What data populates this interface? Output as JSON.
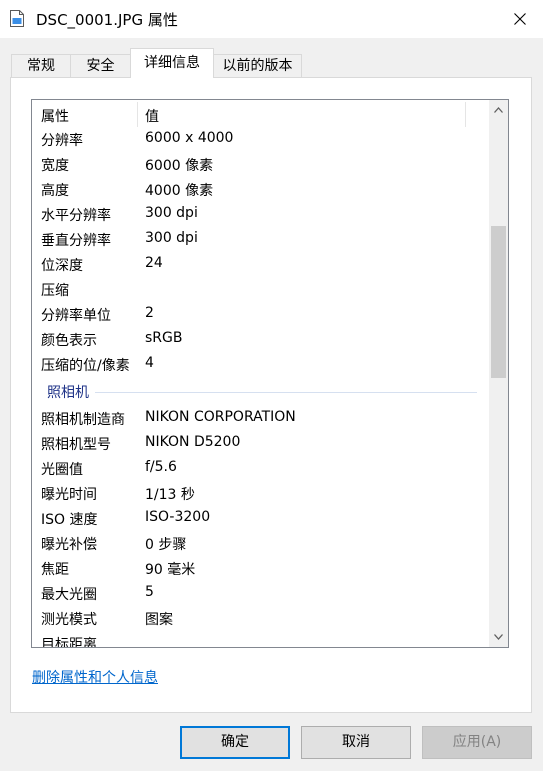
{
  "window": {
    "title": "DSC_0001.JPG 属性",
    "icon": "document-icon",
    "close_icon": "close-icon"
  },
  "tabs": [
    {
      "label": "常规",
      "active": false
    },
    {
      "label": "安全",
      "active": false
    },
    {
      "label": "详细信息",
      "active": true
    },
    {
      "label": "以前的版本",
      "active": false
    }
  ],
  "list": {
    "header": {
      "property": "属性",
      "value": "值"
    },
    "rows": [
      {
        "k": "分辨率",
        "v": "6000 x 4000"
      },
      {
        "k": "宽度",
        "v": "6000 像素"
      },
      {
        "k": "高度",
        "v": "4000 像素"
      },
      {
        "k": "水平分辨率",
        "v": "300 dpi"
      },
      {
        "k": "垂直分辨率",
        "v": "300 dpi"
      },
      {
        "k": "位深度",
        "v": "24"
      },
      {
        "k": "压缩",
        "v": ""
      },
      {
        "k": "分辨率单位",
        "v": "2"
      },
      {
        "k": "颜色表示",
        "v": "sRGB"
      },
      {
        "k": "压缩的位/像素",
        "v": "4"
      }
    ],
    "group": "照相机",
    "camera_rows": [
      {
        "k": "照相机制造商",
        "v": "NIKON CORPORATION"
      },
      {
        "k": "照相机型号",
        "v": "NIKON D5200"
      },
      {
        "k": "光圈值",
        "v": "f/5.6"
      },
      {
        "k": "曝光时间",
        "v": "1/13 秒"
      },
      {
        "k": "ISO 速度",
        "v": "ISO-3200"
      },
      {
        "k": "曝光补偿",
        "v": "0 步骤"
      },
      {
        "k": "焦距",
        "v": "90 毫米"
      },
      {
        "k": "最大光圈",
        "v": "5"
      },
      {
        "k": "测光模式",
        "v": "图案"
      },
      {
        "k": "目标距离",
        "v": ""
      }
    ]
  },
  "remove_link": "删除属性和个人信息",
  "buttons": {
    "ok": "确定",
    "cancel": "取消",
    "apply": "应用(A)"
  },
  "colors": {
    "accent": "#0078d7",
    "link": "#0066cc",
    "group": "#1e3287"
  }
}
